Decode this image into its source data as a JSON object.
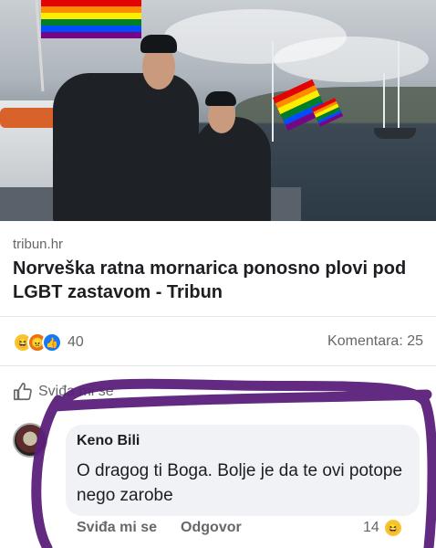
{
  "post": {
    "source": "tribun.hr",
    "headline": "Norveška ratna mornarica ponosno plovi pod LGBT zastavom - Tribun",
    "reaction_count": "40",
    "comments_label": "Komentara: 25",
    "like_label": "Sviđa mi se"
  },
  "comment": {
    "author": "Keno Bili",
    "text": "O dragog ti Boga. Bolje je da te ovi potope nego zarobe",
    "like_action": "Sviđa mi se",
    "reply_action": "Odgovor",
    "reaction_count": "14"
  },
  "icons": {
    "reactions": [
      "haha-icon",
      "angry-icon",
      "like-icon"
    ],
    "like_button": "thumbs-up-icon",
    "comment_reaction": "haha-icon"
  },
  "colors": {
    "annotation": "#5b1f7a",
    "like_blue": "#1877f2",
    "text_secondary": "#65676b"
  }
}
